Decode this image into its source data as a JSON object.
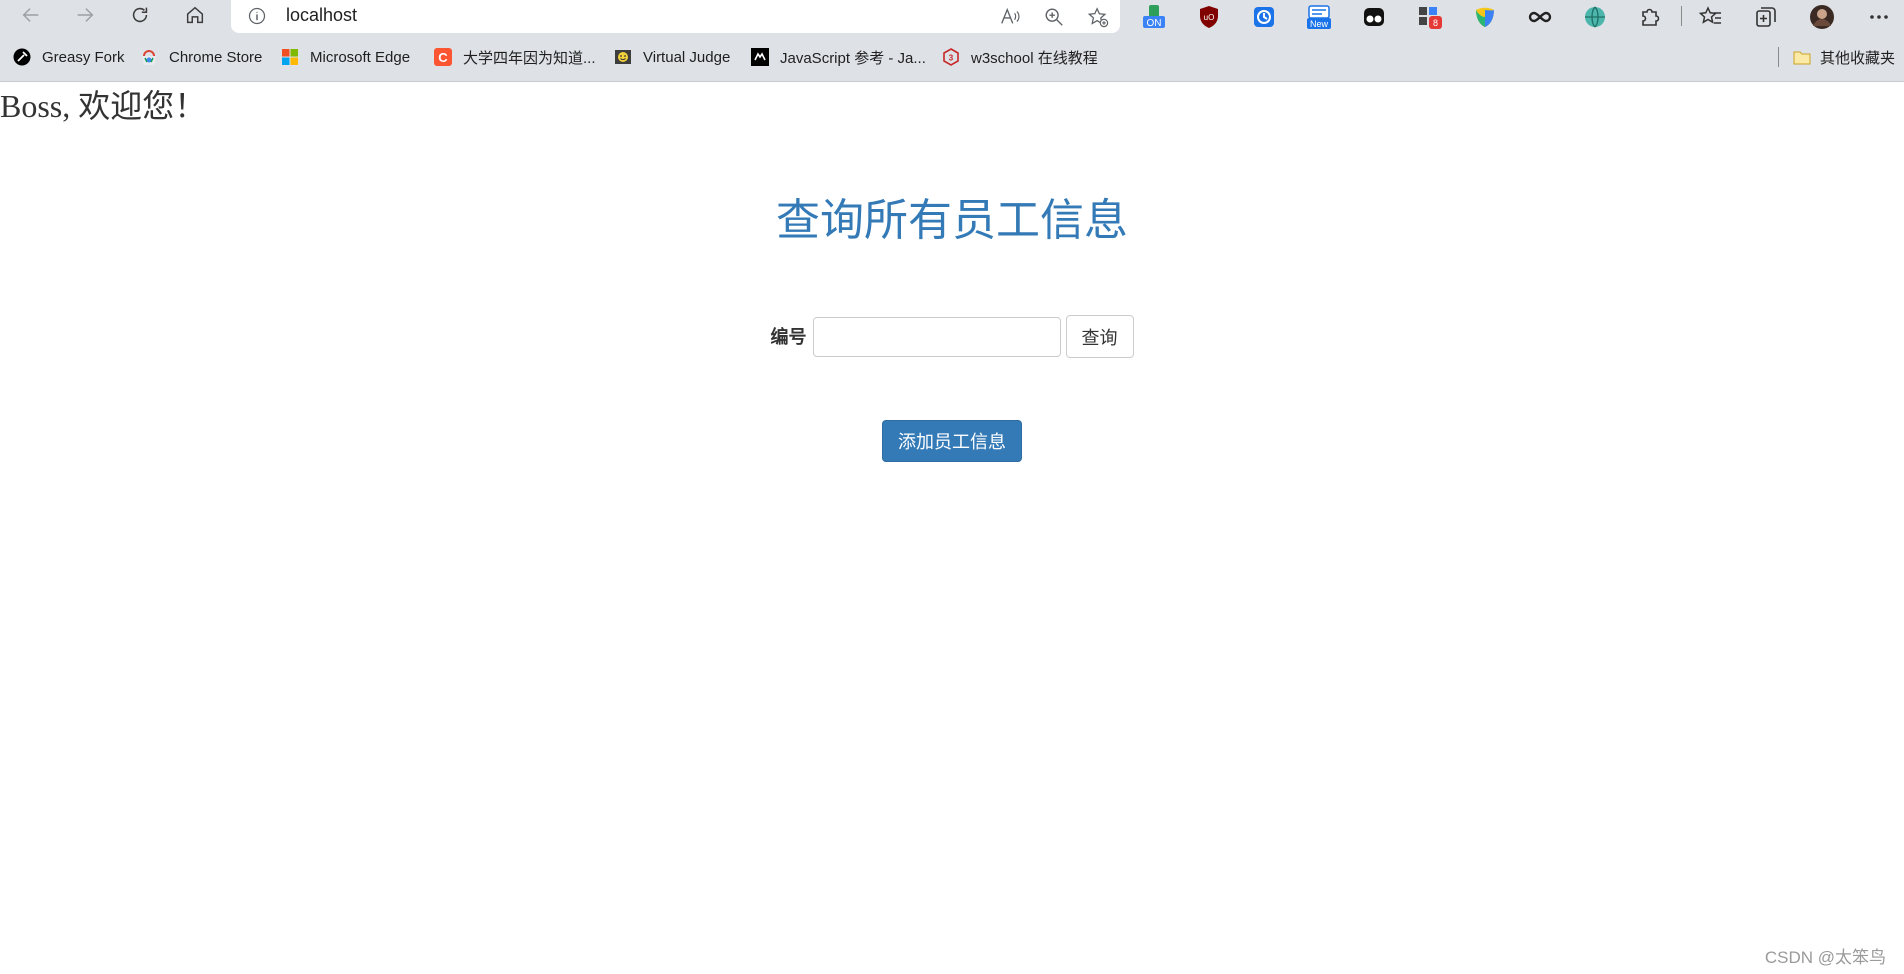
{
  "browser": {
    "url": "localhost",
    "bookmarks": [
      {
        "label": "Greasy Fork",
        "icon": "greasyfork-icon"
      },
      {
        "label": "Chrome Store",
        "icon": "chrome-store-icon"
      },
      {
        "label": "Microsoft Edge",
        "icon": "microsoft-logo-icon"
      },
      {
        "label": "大学四年因为知道...",
        "icon": "csdn-icon"
      },
      {
        "label": "Virtual Judge",
        "icon": "virtual-judge-icon"
      },
      {
        "label": "JavaScript 参考 - Ja...",
        "icon": "mdn-icon"
      },
      {
        "label": "w3school 在线教程",
        "icon": "w3school-icon"
      }
    ],
    "other_favorites": "其他收藏夹",
    "extension_badges": {
      "on": "ON",
      "new": "New",
      "count": "8"
    },
    "colors": {
      "chrome_bg": "#dee1e6",
      "omnibox_bg": "#ffffff"
    }
  },
  "page": {
    "welcome": "Boss, 欢迎您！",
    "heading": "查询所有员工信息",
    "search_label": "编号",
    "search_value": "",
    "search_button": "查询",
    "add_button": "添加员工信息",
    "watermark": "CSDN @太笨鸟",
    "colors": {
      "heading": "#337ab7",
      "primary_button": "#337ab7"
    }
  }
}
